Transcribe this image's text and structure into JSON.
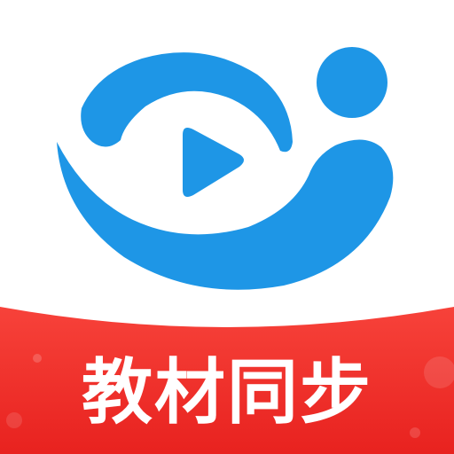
{
  "icon": {
    "banner_text": "教材同步",
    "logo_symbol": "play-icon"
  },
  "colors": {
    "logo_blue": "#1E96E6",
    "banner_red": "#F5322D",
    "banner_red_dark": "#E8221F",
    "background": "#FFFFFF",
    "text": "#FFFFFF"
  }
}
